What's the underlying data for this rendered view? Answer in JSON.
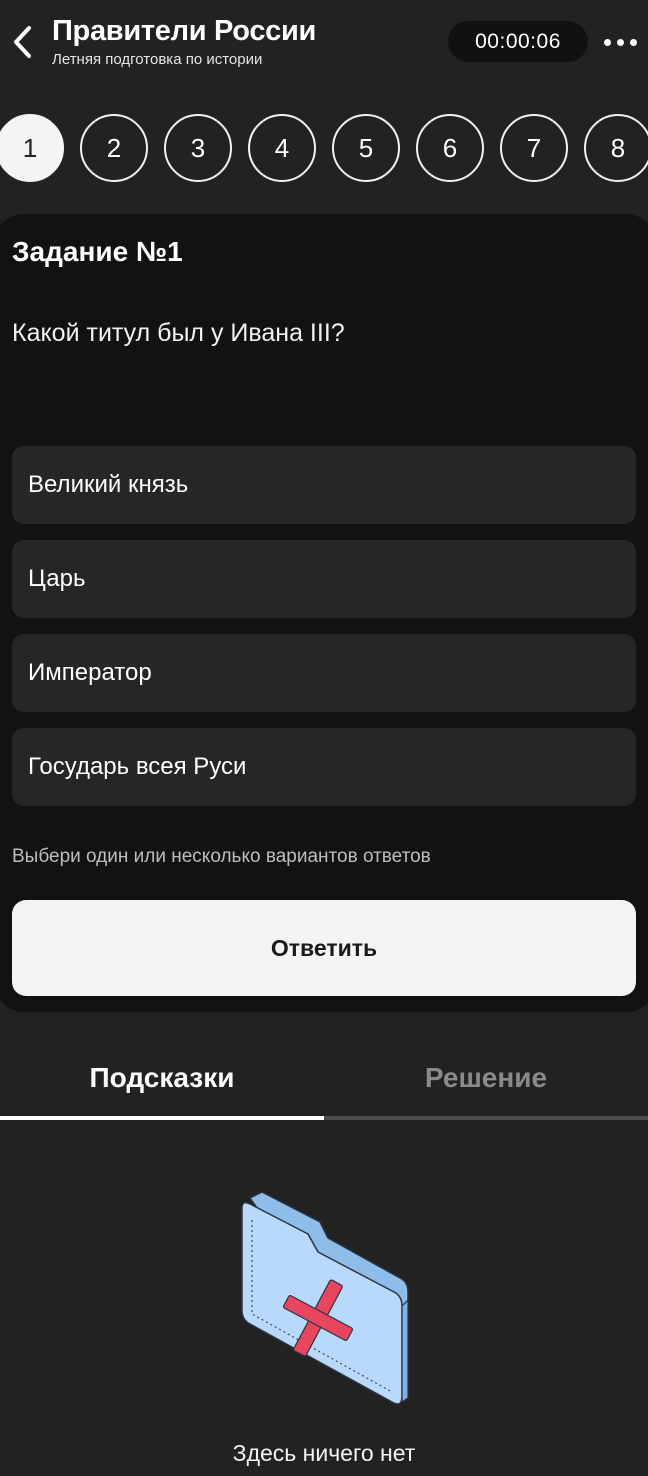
{
  "header": {
    "title": "Правители России",
    "subtitle": "Летняя подготовка по истории",
    "timer": "00:00:06"
  },
  "questions": [
    "1",
    "2",
    "3",
    "4",
    "5",
    "6",
    "7",
    "8"
  ],
  "task": {
    "title": "Задание №1",
    "question": "Какой титул был у Ивана III?",
    "options": [
      "Великий князь",
      "Царь",
      "Император",
      "Государь всея Руси"
    ],
    "hint": "Выбери один или несколько вариантов ответов",
    "answer_label": "Ответить"
  },
  "tabs": [
    {
      "label": "Подсказки"
    },
    {
      "label": "Решение"
    }
  ],
  "empty_state": {
    "text": "Здесь ничего нет"
  },
  "colors": {
    "background": "#222222",
    "card": "#121212",
    "option": "#262626",
    "accent_red": "#e8465f",
    "folder_blue": "#b9d9fb"
  }
}
